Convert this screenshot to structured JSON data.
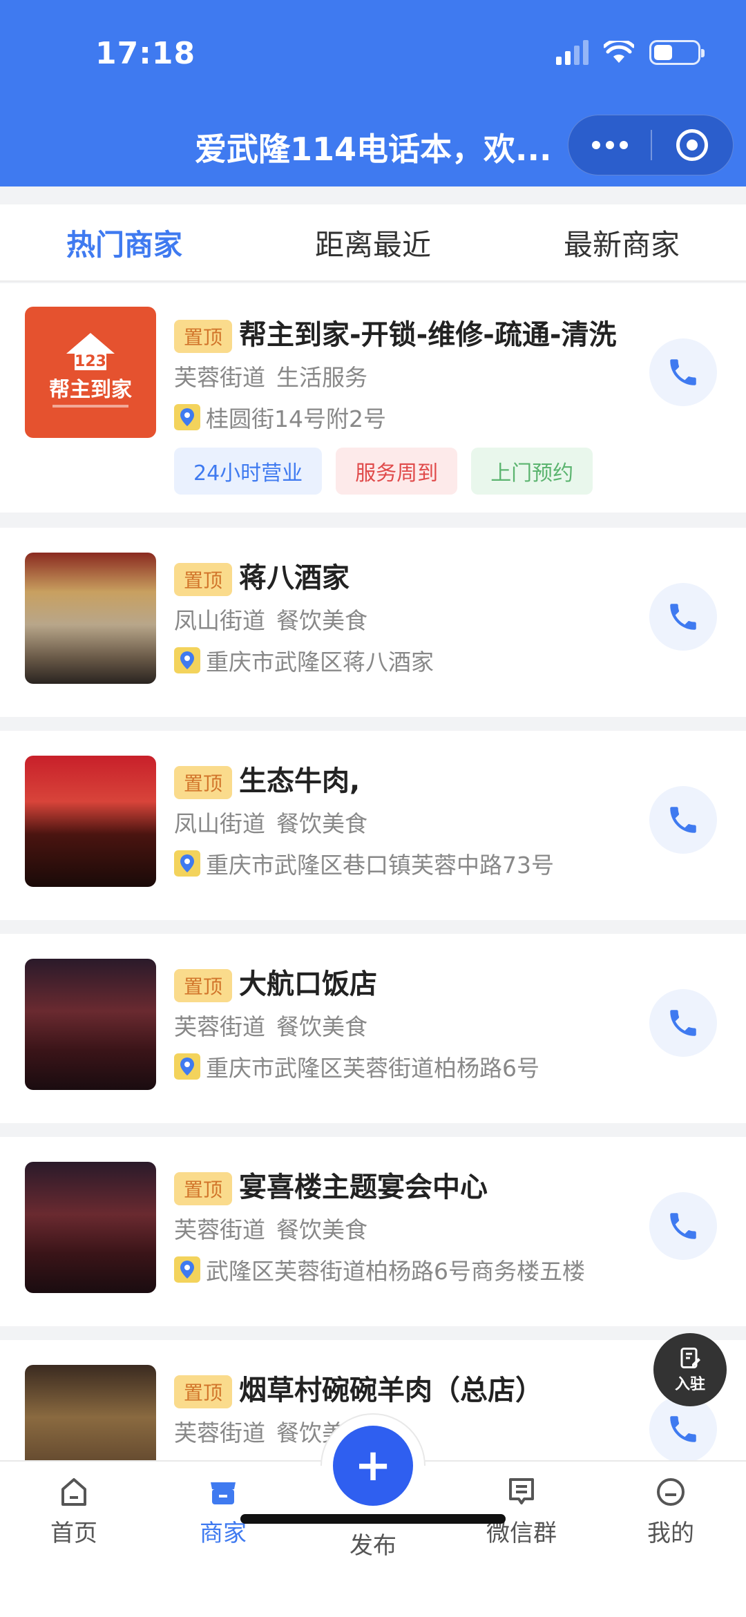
{
  "status": {
    "time": "17:18"
  },
  "navbar": {
    "title": "爱武隆114电话本，欢..."
  },
  "tabs": [
    {
      "label": "热门商家",
      "active": true
    },
    {
      "label": "距离最近",
      "active": false
    },
    {
      "label": "最新商家",
      "active": false
    }
  ],
  "pin_label": "置顶",
  "merchants": [
    {
      "name": "帮主到家-开锁-维修-疏通-清洗",
      "street": "芙蓉街道",
      "category": "生活服务",
      "address": "桂圆街14号附2号",
      "logo_text": "帮主到家",
      "tags": [
        "24小时营业",
        "服务周到",
        "上门预约"
      ]
    },
    {
      "name": "蒋八酒家",
      "street": "凤山街道",
      "category": "餐饮美食",
      "address": "重庆市武隆区蒋八酒家"
    },
    {
      "name": "生态牛肉,",
      "street": "凤山街道",
      "category": "餐饮美食",
      "address": "重庆市武隆区巷口镇芙蓉中路73号"
    },
    {
      "name": "大航口饭店",
      "street": "芙蓉街道",
      "category": "餐饮美食",
      "address": "重庆市武隆区芙蓉街道柏杨路6号"
    },
    {
      "name": "宴喜楼主题宴会中心",
      "street": "芙蓉街道",
      "category": "餐饮美食",
      "address": "武隆区芙蓉街道柏杨路6号商务楼五楼"
    },
    {
      "name": "烟草村碗碗羊肉（总店）",
      "street": "芙蓉街道",
      "category": "餐饮美"
    }
  ],
  "join_label": "入驻",
  "bottom_nav": {
    "home": "首页",
    "merchants": "商家",
    "publish": "发布",
    "wechat_group": "微信群",
    "mine": "我的"
  },
  "colors": {
    "primary": "#3f7af0",
    "pin_bg": "#fadb8c",
    "publish": "#2f5ff0"
  }
}
